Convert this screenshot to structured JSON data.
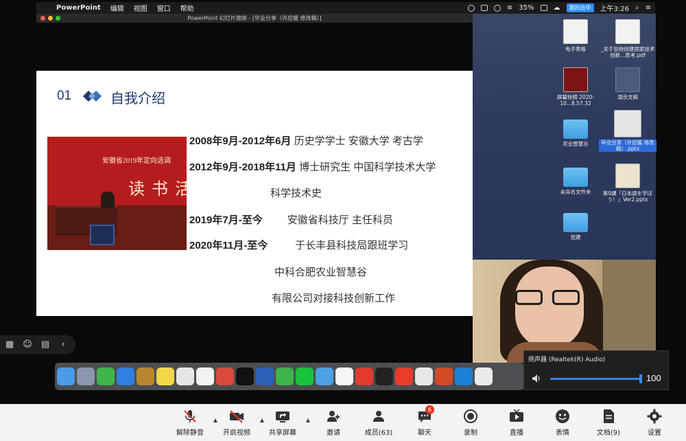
{
  "menubar": {
    "apple_icon": "apple-icon",
    "items": [
      "PowerPoint",
      "编辑",
      "视图",
      "窗口",
      "帮助"
    ],
    "battery": "35%",
    "zoom_chip": "我的云中",
    "clock": "上午3:26"
  },
  "ppt_window": {
    "title": "PowerPoint 幻灯片放映 - [毕业分享（许应媛 修改稿）]"
  },
  "slide": {
    "number": "01",
    "title": "自我介绍",
    "photo_banner_line1": "安徽省2019年定向选调",
    "photo_banner_line2": "读书活",
    "lines": [
      {
        "bold": "2008年9月-2012年6月",
        "text": " 历史学学士  安徽大学  考古学"
      },
      {
        "bold": "2012年9月-2018年11月",
        "text": " 博士研究生  中国科学技术大学"
      },
      {
        "bold": "",
        "text": "科学技术史"
      },
      {
        "bold": "2019年7月-至今",
        "text": "安徽省科技厅 主任科员"
      },
      {
        "bold": "2020年11月-至今",
        "text": "于长丰县科技局跟班学习"
      },
      {
        "bold": "",
        "text": "中科合肥农业智慧谷"
      },
      {
        "bold": "",
        "text": "有限公司对接科技创新工作"
      }
    ]
  },
  "desktop": {
    "icons": [
      {
        "label": "电子表格"
      },
      {
        "label": "_关于加快创建国家技术创新...思考.pdf"
      },
      {
        "label": "屏幕快照 2020-10...8.57.32"
      },
      {
        "label": "演示文稿"
      },
      {
        "label": "农业智慧谷"
      },
      {
        "label": "毕业分享（许应媛 修改稿）.pptx"
      },
      {
        "label": "未命名文件夹"
      },
      {
        "label": "第0課「日本語を学ぼう！」Ver2.pptx"
      },
      {
        "label": "党建"
      }
    ]
  },
  "speaker": {
    "label": "扬声器 (Realtek(R) Audio)",
    "volume": "100",
    "volume_level": 100
  },
  "dock": {
    "apps": [
      "finder",
      "launchpad",
      "facetime",
      "safari",
      "notes",
      "stickies",
      "preview",
      "photos",
      "itunes",
      "qq",
      "word",
      "wechat",
      "iqiyi",
      "preview-2",
      "baidu-netdisk",
      "video-app",
      "cleaner",
      "wps",
      "chrome",
      "powerpoint",
      "edge",
      "more"
    ]
  },
  "zoom_toolbar": {
    "buttons": [
      {
        "label": "解除静音",
        "icon": "mic-muted-icon"
      },
      {
        "label": "开启视频",
        "icon": "video-off-icon"
      },
      {
        "label": "共享屏幕",
        "icon": "share-screen-icon"
      },
      {
        "label": "邀请",
        "icon": "invite-icon"
      },
      {
        "label": "成员(63)",
        "icon": "participants-icon"
      },
      {
        "label": "聊天",
        "icon": "chat-icon",
        "badge": "6"
      },
      {
        "label": "录制",
        "icon": "record-icon"
      },
      {
        "label": "直播",
        "icon": "live-icon"
      },
      {
        "label": "表情",
        "icon": "emoji-icon"
      },
      {
        "label": "文档(9)",
        "icon": "document-icon"
      },
      {
        "label": "设置",
        "icon": "settings-icon"
      }
    ]
  },
  "colors": {
    "slide_title": "#1f3a6e",
    "zoom_blue": "#2d8cff",
    "mute_red": "#e0361f"
  }
}
